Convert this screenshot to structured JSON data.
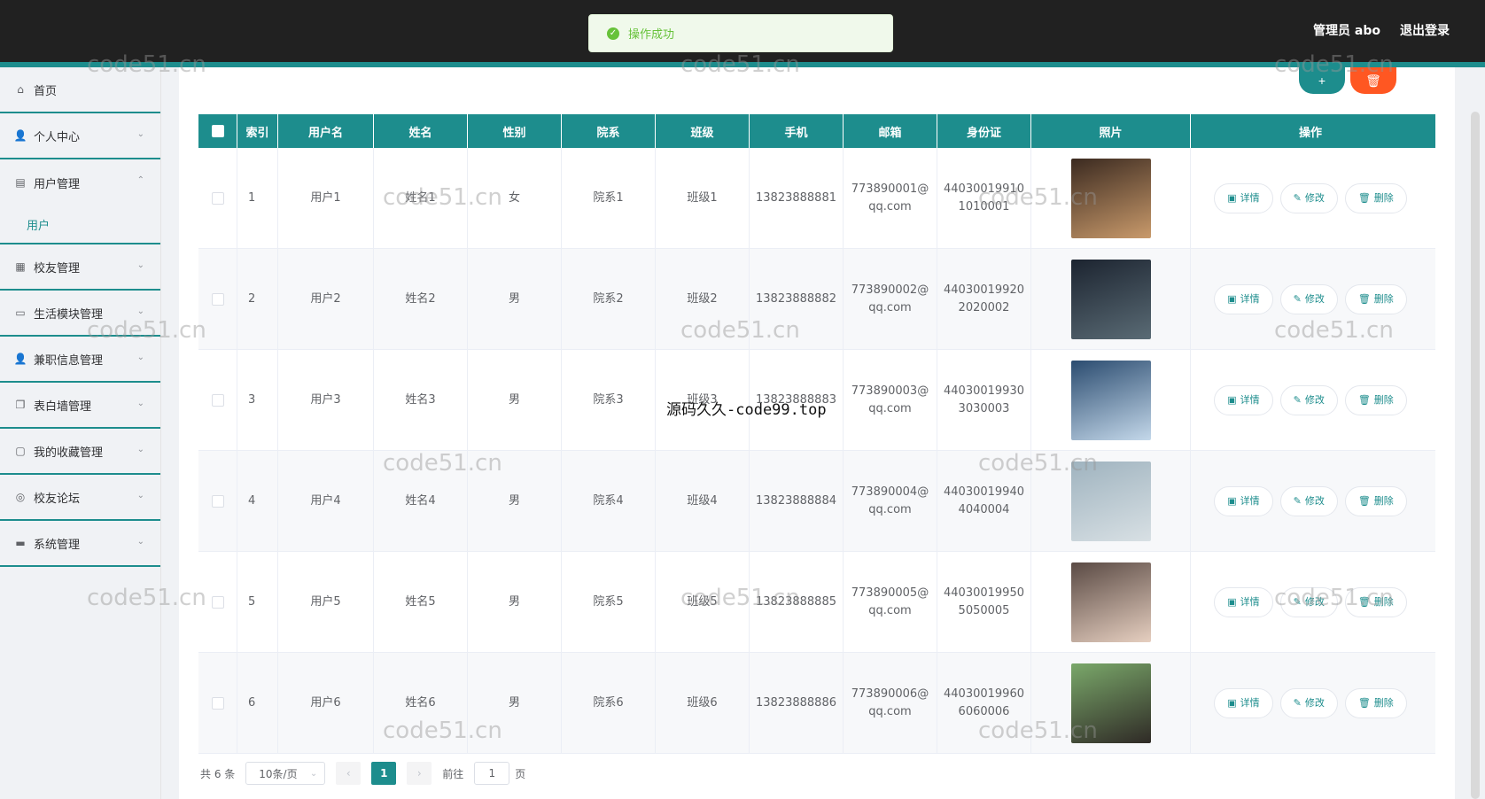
{
  "header": {
    "admin_label": "管理员 abo",
    "logout_label": "退出登录"
  },
  "toast": {
    "message": "操作成功",
    "color": "#67c23a"
  },
  "theme": {
    "accent": "#1d8d8d",
    "danger": "#ff5722",
    "topbar": "#212121"
  },
  "sidebar": {
    "items": [
      {
        "label": "首页",
        "icon": "home-icon"
      },
      {
        "label": "个人中心",
        "icon": "user-icon"
      },
      {
        "label": "用户管理",
        "icon": "users-icon",
        "sub": "用户"
      },
      {
        "label": "校友管理",
        "icon": "clipboard-icon"
      },
      {
        "label": "生活模块管理",
        "icon": "card-icon"
      },
      {
        "label": "兼职信息管理",
        "icon": "person-icon"
      },
      {
        "label": "表白墙管理",
        "icon": "copy-icon"
      },
      {
        "label": "我的收藏管理",
        "icon": "chat-icon"
      },
      {
        "label": "校友论坛",
        "icon": "globe-icon"
      },
      {
        "label": "系统管理",
        "icon": "settings-icon"
      }
    ]
  },
  "table": {
    "headers": [
      "索引",
      "用户名",
      "姓名",
      "性别",
      "院系",
      "班级",
      "手机",
      "邮箱",
      "身份证",
      "照片",
      "操作"
    ],
    "rows": [
      {
        "index": "1",
        "username": "用户1",
        "name": "姓名1",
        "gender": "女",
        "dept": "院系1",
        "class": "班级1",
        "phone": "13823888881",
        "email1": "773890001@",
        "email2": "qq.com",
        "id1": "44030019910",
        "id2": "1010001"
      },
      {
        "index": "2",
        "username": "用户2",
        "name": "姓名2",
        "gender": "男",
        "dept": "院系2",
        "class": "班级2",
        "phone": "13823888882",
        "email1": "773890002@",
        "email2": "qq.com",
        "id1": "44030019920",
        "id2": "2020002"
      },
      {
        "index": "3",
        "username": "用户3",
        "name": "姓名3",
        "gender": "男",
        "dept": "院系3",
        "class": "班级3",
        "phone": "13823888883",
        "email1": "773890003@",
        "email2": "qq.com",
        "id1": "44030019930",
        "id2": "3030003"
      },
      {
        "index": "4",
        "username": "用户4",
        "name": "姓名4",
        "gender": "男",
        "dept": "院系4",
        "class": "班级4",
        "phone": "13823888884",
        "email1": "773890004@",
        "email2": "qq.com",
        "id1": "44030019940",
        "id2": "4040004"
      },
      {
        "index": "5",
        "username": "用户5",
        "name": "姓名5",
        "gender": "男",
        "dept": "院系5",
        "class": "班级5",
        "phone": "13823888885",
        "email1": "773890005@",
        "email2": "qq.com",
        "id1": "44030019950",
        "id2": "5050005"
      },
      {
        "index": "6",
        "username": "用户6",
        "name": "姓名6",
        "gender": "男",
        "dept": "院系6",
        "class": "班级6",
        "phone": "13823888886",
        "email1": "773890006@",
        "email2": "qq.com",
        "id1": "44030019960",
        "id2": "6060006"
      }
    ],
    "actions": {
      "detail": "详情",
      "edit": "修改",
      "delete": "删除"
    }
  },
  "pager": {
    "total": "共 6 条",
    "page_size": "10条/页",
    "current": "1",
    "goto_prefix": "前往",
    "goto_value": "1",
    "goto_suffix": "页"
  },
  "watermarks": {
    "site": "code51.cn",
    "center": "源码久久-code99.top"
  }
}
